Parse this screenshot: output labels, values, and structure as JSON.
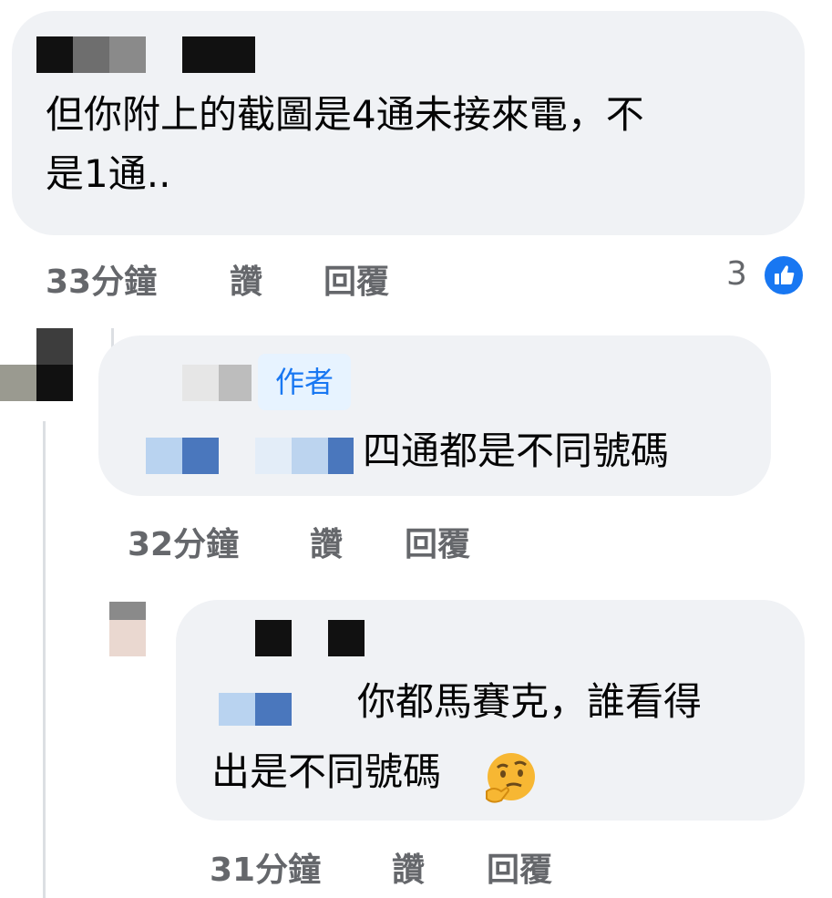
{
  "comments": [
    {
      "text_line1": "但你附上的截圖是4通未接來電，不",
      "text_line2": "是1通..",
      "time": "33分鐘",
      "like_label": "讚",
      "reply_label": "回覆",
      "reaction_count": "3"
    },
    {
      "badge": "作者",
      "text": "四通都是不同號碼",
      "time": "32分鐘",
      "like_label": "讚",
      "reply_label": "回覆"
    },
    {
      "text_line1": "你都馬賽克，誰看得",
      "text_line2": "出是不同號碼",
      "time": "31分鐘",
      "like_label": "讚",
      "reply_label": "回覆"
    }
  ],
  "colors": {
    "bubble": "#f0f2f5",
    "meta_text": "#65676b",
    "badge_bg": "#e7f3ff",
    "badge_text": "#1877f2",
    "like_blue": "#1877f2"
  },
  "icons": {
    "like": "thumbs-up-icon",
    "emoji": "thinking-face-emoji"
  }
}
